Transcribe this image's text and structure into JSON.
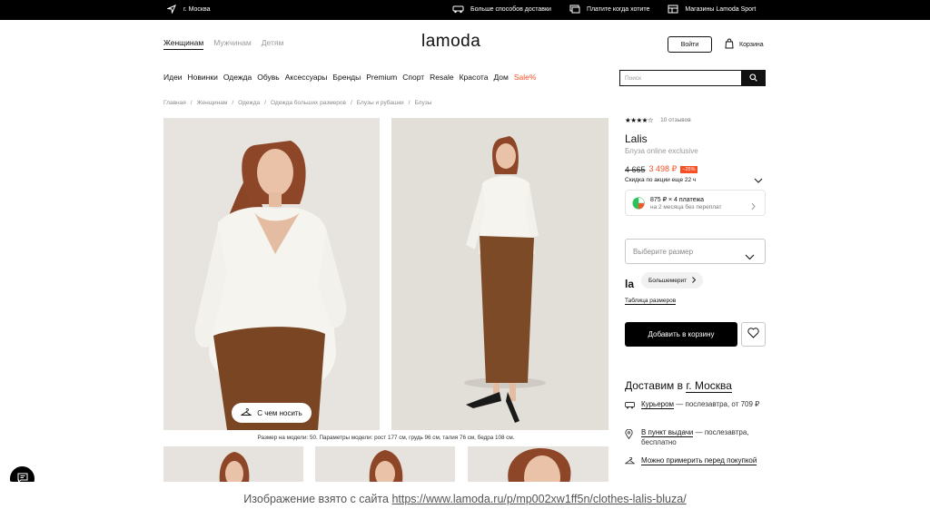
{
  "topbar": {
    "city": "г. Москва",
    "items": [
      "Больше способов доставки",
      "Платите когда хотите",
      "Магазины Lamoda Sport"
    ]
  },
  "header": {
    "gender_tabs": [
      "Женщинам",
      "Мужчинам",
      "Детям"
    ],
    "logo": "lamoda",
    "login": "Войти",
    "cart": "Корзина"
  },
  "nav": {
    "items": [
      "Идеи",
      "Новинки",
      "Одежда",
      "Обувь",
      "Аксессуары",
      "Бренды",
      "Premium",
      "Спорт",
      "Resale",
      "Красота",
      "Дом",
      "Sale%"
    ],
    "sale_color": "#f65026"
  },
  "search": {
    "placeholder": "Поиск"
  },
  "breadcrumbs": [
    "Главная",
    "Женщинам",
    "Одежда",
    "Одежда больших размеров",
    "Блузы и рубашки",
    "Блузы"
  ],
  "gallery": {
    "wear_button": "С чем носить",
    "model_params": "Размер на модели: 50. Параметры модели: рост 177 см, грудь 96 см, талия 76 см, бедра 108 см."
  },
  "product": {
    "rating_stars": 4,
    "reviews": "10 отзывов",
    "brand": "Lalis",
    "name": "Блуза online exclusive",
    "old_price": "4 665",
    "new_price": "3 498 ₽",
    "discount": "−25%",
    "sale_until": "Скидка по акции еще 22 ч",
    "installment_line1": "875 ₽ × 4 платежа",
    "installment_line2": "на 2 месяца без переплат",
    "size_placeholder": "Выберите размер",
    "size_brand_logo": "la",
    "size_badge": "Большемерит",
    "size_table": "Таблица размеров",
    "add_to_cart": "Добавить в корзину",
    "accent_color": "#f65026"
  },
  "delivery": {
    "title_prefix": "Доставим в",
    "city": "г. Москва",
    "courier_link": "Курьером",
    "courier_rest": " — послезавтра, от 709 ₽",
    "pickup_link": "В пункт выдачи",
    "pickup_rest": " — послезавтра, бесплатно",
    "try_on": "Можно примерить перед покупкой"
  },
  "source": {
    "prefix": "Изображение взято с сайта ",
    "url": "https://www.lamoda.ru/p/mp002xw1ff5n/clothes-lalis-bluza/"
  }
}
